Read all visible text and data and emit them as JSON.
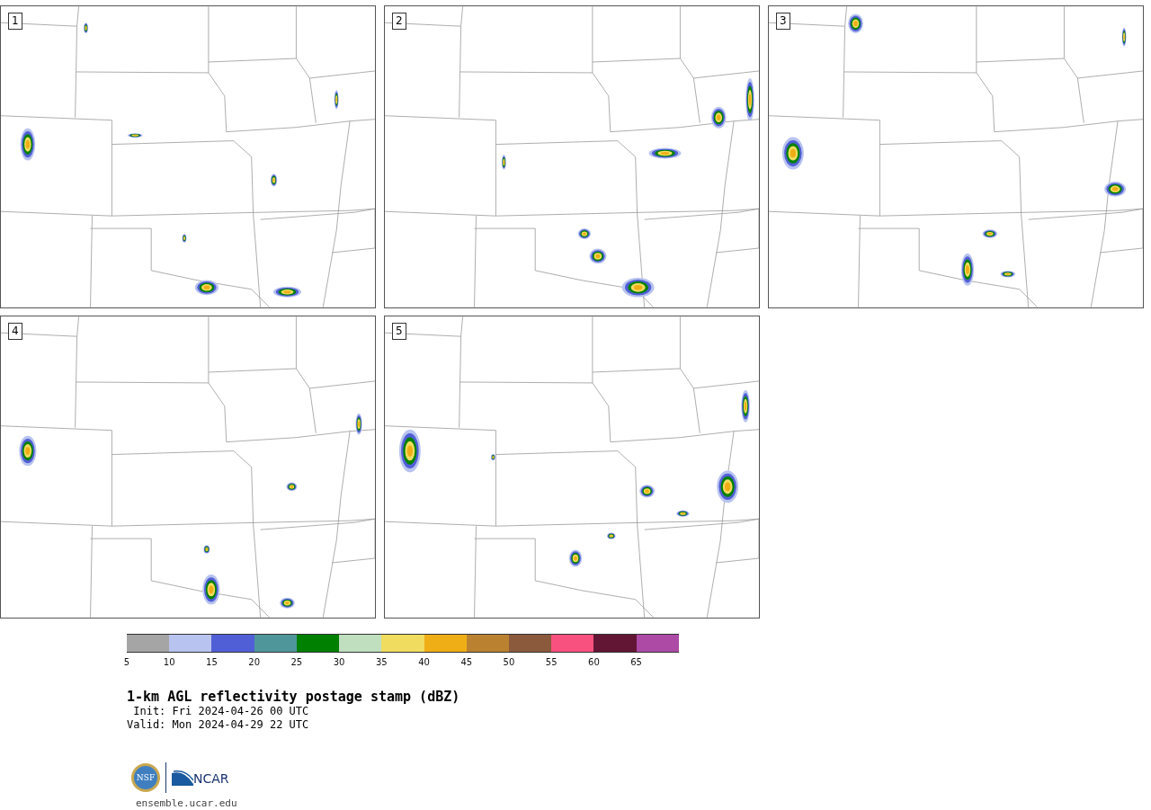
{
  "panels": [
    {
      "label": "1"
    },
    {
      "label": "2"
    },
    {
      "label": "3"
    },
    {
      "label": "4"
    },
    {
      "label": "5"
    }
  ],
  "colorbar": {
    "segments": [
      {
        "color": "#a5a5a5",
        "tick": "5"
      },
      {
        "color": "#b8c3ef",
        "tick": "10"
      },
      {
        "color": "#515fd6",
        "tick": "15"
      },
      {
        "color": "#4f969b",
        "tick": "20"
      },
      {
        "color": "#008000",
        "tick": "25"
      },
      {
        "color": "#bfdfbf",
        "tick": "30"
      },
      {
        "color": "#f0dc5f",
        "tick": "35"
      },
      {
        "color": "#f0ae16",
        "tick": "40"
      },
      {
        "color": "#ba8230",
        "tick": "45"
      },
      {
        "color": "#8b5a3d",
        "tick": "50"
      },
      {
        "color": "#f85180",
        "tick": "55"
      },
      {
        "color": "#621634",
        "tick": "60"
      },
      {
        "color": "#ac4aa6",
        "tick": "65"
      }
    ]
  },
  "title": "1-km AGL reflectivity postage stamp (dBZ)",
  "init": " Init: Fri 2024-04-26 00 UTC",
  "valid": "Valid: Mon 2024-04-29 22 UTC",
  "logos": {
    "nsf": "NSF",
    "ncar": "NCAR"
  },
  "url": "ensemble.ucar.edu"
}
